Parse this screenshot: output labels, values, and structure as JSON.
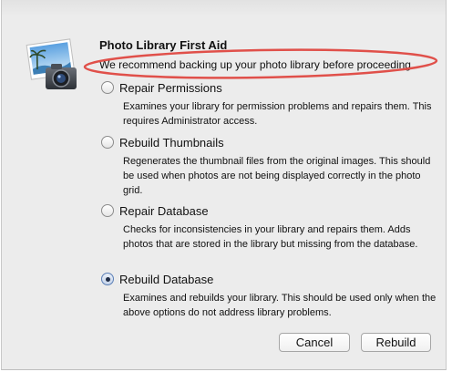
{
  "dialog": {
    "title": "Photo Library First Aid",
    "warning": "We recommend backing up your photo library before proceeding.",
    "icon": "iphoto-camera-icon"
  },
  "options": [
    {
      "label": "Repair Permissions",
      "description": "Examines your library for permission problems and repairs them. This requires Administrator access.",
      "selected": false
    },
    {
      "label": "Rebuild Thumbnails",
      "description": "Regenerates the thumbnail files from the original images. This should be used when photos are not being displayed correctly in the photo grid.",
      "selected": false
    },
    {
      "label": "Repair Database",
      "description": "Checks for inconsistencies in your library and repairs them. Adds photos that are stored in the library but missing from the database.",
      "selected": false
    },
    {
      "label": "Rebuild Database",
      "description": "Examines and rebuilds your library. This should be used only when the above options do not address library problems.",
      "selected": true
    }
  ],
  "buttons": {
    "cancel": "Cancel",
    "rebuild": "Rebuild"
  },
  "annotation": {
    "ellipse_color": "#e0504a"
  }
}
